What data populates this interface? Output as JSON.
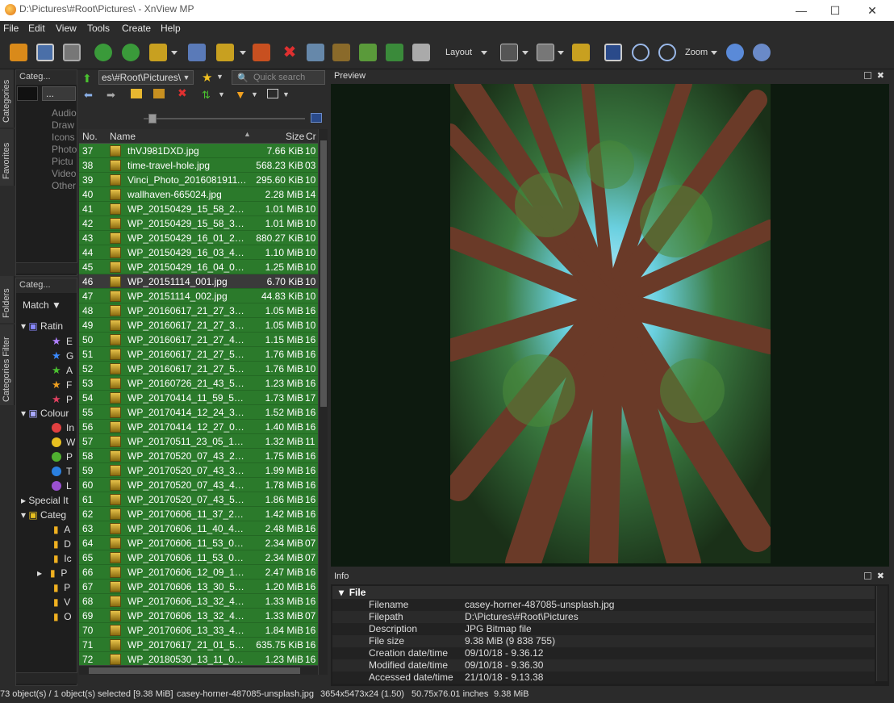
{
  "window": {
    "title": "D:\\Pictures\\#Root\\Pictures\\ - XnView MP"
  },
  "menu": [
    "File",
    "Edit",
    "View",
    "Tools",
    "Create",
    "Help"
  ],
  "toolbar": {
    "layout_label": "Layout",
    "zoom_label": "Zoom"
  },
  "side_tabs": [
    "Categories",
    "Favorites",
    "Folders",
    "Categories Filter"
  ],
  "categories_panel": {
    "title": "Categ...",
    "dropdown_value": "...",
    "items": [
      "Audio",
      "Draw",
      "Icons",
      "Photo",
      "Pictu",
      "Video",
      "Other"
    ]
  },
  "categories_filter": {
    "title": "Categ...",
    "match_label": "Match",
    "ratings_label": "Ratin",
    "ratings": [
      "E",
      "G",
      "A",
      "F",
      "P"
    ],
    "colours_label": "Colour",
    "colours": [
      "In",
      "W",
      "P",
      "T",
      "L"
    ],
    "special_label": "Special It",
    "categories_label": "Categ",
    "cat_items": [
      "A",
      "D",
      "Ic",
      "P",
      "P",
      "V",
      "O"
    ]
  },
  "path_bar": {
    "value": "es\\#Root\\Pictures\\",
    "search_placeholder": "Quick search"
  },
  "file_list": {
    "columns": {
      "no": "No.",
      "name": "Name",
      "size": "Size",
      "created": "Cr"
    },
    "rows": [
      {
        "no": "37",
        "name": "thVJ981DXD.jpg",
        "size": "7.66 KiB",
        "cr": "10"
      },
      {
        "no": "38",
        "name": "time-travel-hole.jpg",
        "size": "568.23 KiB",
        "cr": "03"
      },
      {
        "no": "39",
        "name": "Vinci_Photo_201608191112...",
        "size": "295.60 KiB",
        "cr": "10"
      },
      {
        "no": "40",
        "name": "wallhaven-665024.jpg",
        "size": "2.28 MiB",
        "cr": "14"
      },
      {
        "no": "41",
        "name": "WP_20150429_15_58_23_Pr...",
        "size": "1.01 MiB",
        "cr": "10"
      },
      {
        "no": "42",
        "name": "WP_20150429_15_58_36_Pr...",
        "size": "1.01 MiB",
        "cr": "10"
      },
      {
        "no": "43",
        "name": "WP_20150429_16_01_29_Pr...",
        "size": "880.27 KiB",
        "cr": "10"
      },
      {
        "no": "44",
        "name": "WP_20150429_16_03_44_Pr...",
        "size": "1.10 MiB",
        "cr": "10"
      },
      {
        "no": "45",
        "name": "WP_20150429_16_04_01_Pr...",
        "size": "1.25 MiB",
        "cr": "10"
      },
      {
        "no": "46",
        "name": "WP_20151114_001.jpg",
        "size": "6.70 KiB",
        "cr": "10",
        "selected": true
      },
      {
        "no": "47",
        "name": "WP_20151114_002.jpg",
        "size": "44.83 KiB",
        "cr": "10"
      },
      {
        "no": "48",
        "name": "WP_20160617_21_27_34_Pr...",
        "size": "1.05 MiB",
        "cr": "16"
      },
      {
        "no": "49",
        "name": "WP_20160617_21_27_34_Pr...",
        "size": "1.05 MiB",
        "cr": "10"
      },
      {
        "no": "50",
        "name": "WP_20160617_21_27_42_Pr...",
        "size": "1.15 MiB",
        "cr": "16"
      },
      {
        "no": "51",
        "name": "WP_20160617_21_27_54_Pr...",
        "size": "1.76 MiB",
        "cr": "16"
      },
      {
        "no": "52",
        "name": "WP_20160617_21_27_54_Pr...",
        "size": "1.76 MiB",
        "cr": "10"
      },
      {
        "no": "53",
        "name": "WP_20160726_21_43_54_Pr...",
        "size": "1.23 MiB",
        "cr": "16"
      },
      {
        "no": "54",
        "name": "WP_20170414_11_59_51_Pr...",
        "size": "1.73 MiB",
        "cr": "17"
      },
      {
        "no": "55",
        "name": "WP_20170414_12_24_32_Pr...",
        "size": "1.52 MiB",
        "cr": "16"
      },
      {
        "no": "56",
        "name": "WP_20170414_12_27_07_Pr...",
        "size": "1.40 MiB",
        "cr": "16"
      },
      {
        "no": "57",
        "name": "WP_20170511_23_05_19_Pr...",
        "size": "1.32 MiB",
        "cr": "11"
      },
      {
        "no": "58",
        "name": "WP_20170520_07_43_21_Pr...",
        "size": "1.75 MiB",
        "cr": "16"
      },
      {
        "no": "59",
        "name": "WP_20170520_07_43_37_Pr...",
        "size": "1.99 MiB",
        "cr": "16"
      },
      {
        "no": "60",
        "name": "WP_20170520_07_43_47_Pr...",
        "size": "1.78 MiB",
        "cr": "16"
      },
      {
        "no": "61",
        "name": "WP_20170520_07_43_57_Pr...",
        "size": "1.86 MiB",
        "cr": "16"
      },
      {
        "no": "62",
        "name": "WP_20170606_11_37_23_Pr...",
        "size": "1.42 MiB",
        "cr": "16"
      },
      {
        "no": "63",
        "name": "WP_20170606_11_40_44_Pr...",
        "size": "2.48 MiB",
        "cr": "16"
      },
      {
        "no": "64",
        "name": "WP_20170606_11_53_06_Pr...",
        "size": "2.34 MiB",
        "cr": "07"
      },
      {
        "no": "65",
        "name": "WP_20170606_11_53_06_Pr...",
        "size": "2.34 MiB",
        "cr": "07"
      },
      {
        "no": "66",
        "name": "WP_20170606_12_09_17_Pr...",
        "size": "2.47 MiB",
        "cr": "16"
      },
      {
        "no": "67",
        "name": "WP_20170606_13_30_56_Pr...",
        "size": "1.20 MiB",
        "cr": "16"
      },
      {
        "no": "68",
        "name": "WP_20170606_13_32_41_Pr...",
        "size": "1.33 MiB",
        "cr": "16"
      },
      {
        "no": "69",
        "name": "WP_20170606_13_32_41_Pr...",
        "size": "1.33 MiB",
        "cr": "07"
      },
      {
        "no": "70",
        "name": "WP_20170606_13_33_46_Pr...",
        "size": "1.84 MiB",
        "cr": "16"
      },
      {
        "no": "71",
        "name": "WP_20170617_21_01_55_Pr...",
        "size": "635.75 KiB",
        "cr": "16"
      },
      {
        "no": "72",
        "name": "WP_20180530_13_11_00_Pr...",
        "size": "1.23 MiB",
        "cr": "16"
      }
    ]
  },
  "preview": {
    "title": "Preview"
  },
  "info": {
    "title": "Info",
    "section": "File",
    "fields": [
      {
        "k": "Filename",
        "v": "casey-horner-487085-unsplash.jpg"
      },
      {
        "k": "Filepath",
        "v": "D:\\Pictures\\#Root\\Pictures"
      },
      {
        "k": "Description",
        "v": "JPG Bitmap file"
      },
      {
        "k": "File size",
        "v": "9.38 MiB (9 838 755)"
      },
      {
        "k": "Creation date/time",
        "v": "09/10/18 - 9.36.12"
      },
      {
        "k": "Modified date/time",
        "v": "09/10/18 - 9.36.30"
      },
      {
        "k": "Accessed date/time",
        "v": "21/10/18 - 9.13.38"
      }
    ]
  },
  "status": {
    "count": "73 object(s) / 1 object(s) selected [9.38 MiB]",
    "filename": "casey-horner-487085-unsplash.jpg",
    "dims": "3654x5473x24 (1.50)",
    "inches": "50.75x76.01 inches",
    "size": "9.38 MiB"
  },
  "colors": {
    "selected_row": "#2b7a2b",
    "bg": "#2b2b2b"
  }
}
